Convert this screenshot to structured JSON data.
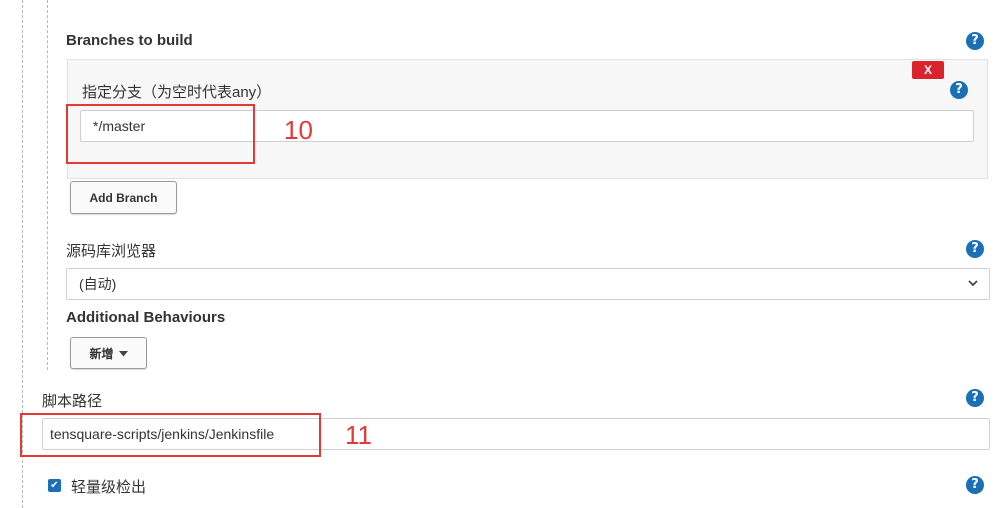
{
  "branches": {
    "title": "Branches to build",
    "branch_spec": {
      "label": "指定分支（为空时代表any）",
      "value": "*/master",
      "delete_label": "X"
    },
    "add_button": "Add Branch"
  },
  "repo_browser": {
    "label": "源码库浏览器",
    "selected": "(自动)"
  },
  "behaviours": {
    "title": "Additional Behaviours",
    "add_button": "新增"
  },
  "script_path": {
    "label": "脚本路径",
    "value": "tensquare-scripts/jenkins/Jenkinsfile"
  },
  "lightweight": {
    "label": "轻量级检出",
    "checked": true
  },
  "annotations": {
    "first": "10",
    "second": "11"
  },
  "icons": {
    "help": "question-circle-icon",
    "dropdown": "chevron-down-icon",
    "caret": "caret-down-icon",
    "check": "check-icon"
  },
  "colors": {
    "help_icon": "#1a6fb5",
    "delete_button": "#d9232d",
    "annotation": "#e53935"
  }
}
